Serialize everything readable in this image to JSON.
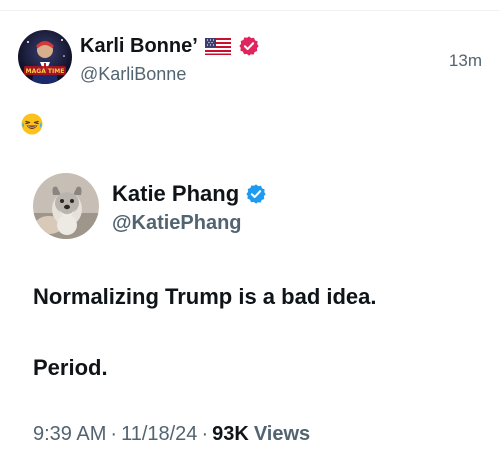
{
  "outer_tweet": {
    "display_name": "Karli Bonne’",
    "handle": "@KarliBonne",
    "timestamp": "13m",
    "flag_icon": "us-flag-icon",
    "verified_icon": "verified-badge-icon",
    "verified_color": "#e0245e",
    "body_emoji": "😂",
    "avatar_text": "MAGA TIME"
  },
  "quoted_tweet": {
    "display_name": "Katie Phang",
    "handle": "@KatiePhang",
    "verified_icon": "verified-badge-icon",
    "verified_color": "#1d9bf0",
    "text_line_1": "Normalizing Trump is a bad idea.",
    "text_line_2": "Period.",
    "time": "9:39 AM",
    "separator": "·",
    "date": "11/18/24",
    "views_count": "93K",
    "views_label": "Views"
  },
  "colors": {
    "primary_text": "#0f1419",
    "secondary_text": "#536471"
  }
}
